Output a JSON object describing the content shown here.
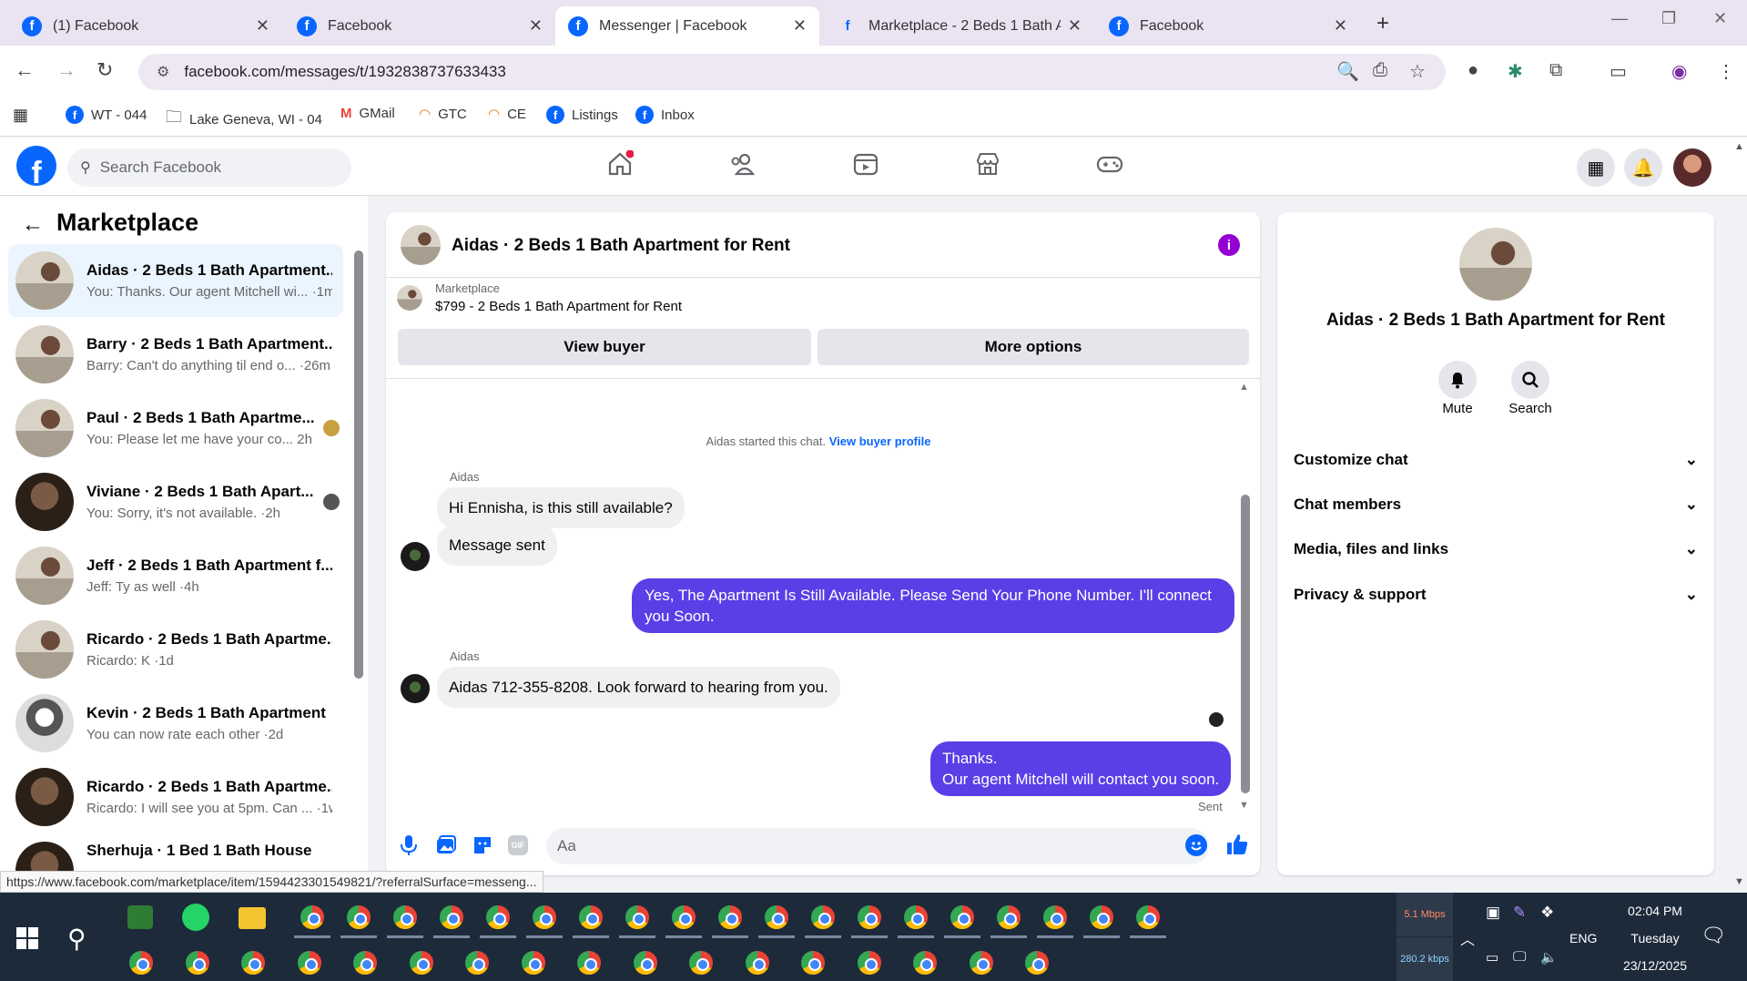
{
  "tabs": [
    {
      "title": "(1) Facebook"
    },
    {
      "title": "Facebook"
    },
    {
      "title": "Messenger | Facebook"
    },
    {
      "title": "Marketplace - 2 Beds 1 Bath Ap"
    },
    {
      "title": "Facebook"
    }
  ],
  "address": {
    "url": "facebook.com/messages/t/1932838737633433"
  },
  "bookmarks": [
    {
      "label": "WT - 044"
    },
    {
      "label": "Lake Geneva, WI - 04"
    },
    {
      "label": "GMail"
    },
    {
      "label": "GTC"
    },
    {
      "label": "CE"
    },
    {
      "label": "Listings"
    },
    {
      "label": "Inbox"
    }
  ],
  "fb": {
    "search_placeholder": "Search Facebook"
  },
  "left": {
    "title": "Marketplace",
    "conversations": [
      {
        "name": "Aidas · 2 Beds 1 Bath Apartment...",
        "preview": "You: Thanks. Our agent Mitchell wi... ·1m"
      },
      {
        "name": "Barry · 2 Beds 1 Bath Apartment...",
        "preview": "Barry: Can't do anything til end o... ·26m"
      },
      {
        "name": "Paul · 2 Beds 1 Bath Apartme...",
        "preview": "You: Please let me have your co...  2h"
      },
      {
        "name": "Viviane · 2 Beds 1 Bath Apart...",
        "preview": "You: Sorry, it's not available. ·2h"
      },
      {
        "name": "Jeff · 2 Beds 1 Bath Apartment f...",
        "preview": "Jeff: Ty as well ·4h"
      },
      {
        "name": "Ricardo · 2 Beds 1 Bath Apartme...",
        "preview": "Ricardo: K ·1d"
      },
      {
        "name": "Kevin · 2 Beds 1 Bath Apartment",
        "preview": "You can now rate each other ·2d"
      },
      {
        "name": "Ricardo · 2 Beds 1 Bath Apartme...",
        "preview": "Ricardo: I will see you at 5pm. Can ... ·1w"
      },
      {
        "name": "Sherhuja · 1 Bed 1 Bath House",
        "preview": ""
      }
    ]
  },
  "chat": {
    "title": "Aidas · 2 Beds 1 Bath Apartment for Rent",
    "listing_label": "Marketplace",
    "listing_price": "$799 - 2 Beds 1 Bath Apartment for Rent",
    "view_buyer": "View buyer",
    "more_options": "More options",
    "started_text": "Aidas started this chat.",
    "view_profile": "View buyer profile",
    "sender1": "Aidas",
    "msg1": "Hi Ennisha, is this still available?",
    "msg2": "Message sent",
    "msg3": "Yes, The Apartment Is Still Available. Please Send Your Phone Number. I'll connect you Soon.",
    "sender2": "Aidas",
    "msg4": "Aidas 712-355-8208. Look forward to hearing from you.",
    "msg5_line1": "Thanks.",
    "msg5_line2": "Our agent Mitchell will contact you soon.",
    "sent": "Sent",
    "composer_placeholder": "Aa"
  },
  "right": {
    "title": "Aidas · 2 Beds 1 Bath Apartment for Rent",
    "mute": "Mute",
    "search": "Search",
    "sections": [
      "Customize chat",
      "Chat members",
      "Media, files and links",
      "Privacy & support"
    ]
  },
  "status_url": "https://www.facebook.com/marketplace/item/1594423301549821/?referralSurface=messeng...",
  "taskbar": {
    "upload": "5.1 Mbps",
    "download": "280.2 kbps",
    "lang": "ENG",
    "time": "02:04 PM",
    "day": "Tuesday",
    "date": "23/12/2025"
  },
  "colors": {
    "fb_blue": "#0866ff",
    "outgoing": "#5b3ee6",
    "info": "#9400d3"
  }
}
